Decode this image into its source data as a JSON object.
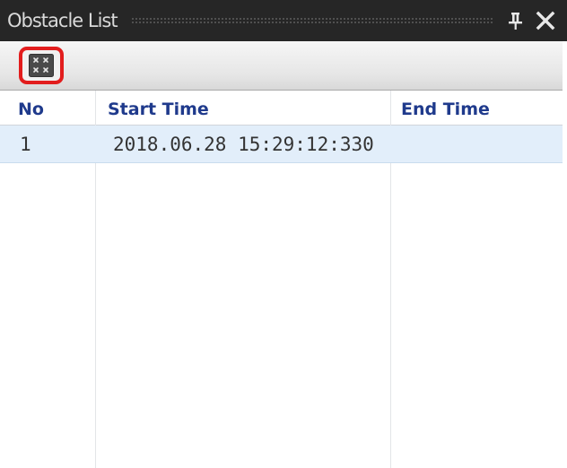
{
  "window": {
    "title": "Obstacle List",
    "pin_icon": "pin-icon",
    "close_icon": "close-icon"
  },
  "toolbar": {
    "button_icon": "clear-all-icon",
    "highlight_color": "#e21d1d"
  },
  "grid": {
    "columns": [
      "No",
      "Start Time",
      "End Time"
    ],
    "rows": [
      {
        "no": "1",
        "start_time": "2018.06.28 15:29:12:330",
        "end_time": ""
      }
    ],
    "header_color": "#1f3a8c",
    "selected_row_color": "#e2eefa"
  },
  "colors": {
    "titlebar": "#262626",
    "title_text": "#d9d9d9"
  }
}
